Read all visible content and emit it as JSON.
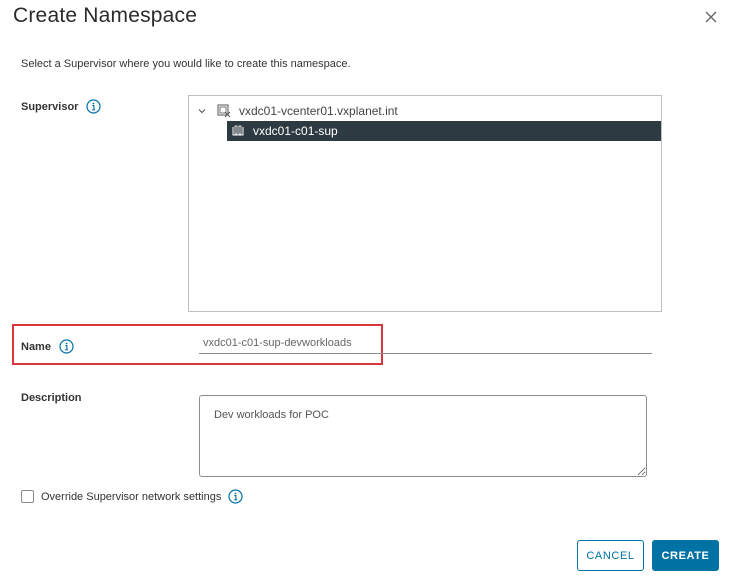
{
  "dialog": {
    "title": "Create Namespace",
    "subtitle": "Select a Supervisor where you would like to create this namespace."
  },
  "supervisor": {
    "label": "Supervisor",
    "tree": {
      "parent": "vxdc01-vcenter01.vxplanet.int",
      "selected_child": "vxdc01-c01-sup"
    }
  },
  "name": {
    "label": "Name",
    "value": "vxdc01-c01-sup-devworkloads"
  },
  "description": {
    "label": "Description",
    "value": "Dev workloads for POC"
  },
  "override": {
    "label": "Override Supervisor network settings",
    "checked": false
  },
  "buttons": {
    "cancel": "CANCEL",
    "create": "CREATE"
  },
  "colors": {
    "accent": "#0072a3",
    "selected_row": "#2d3a42",
    "highlight": "#d9363e"
  }
}
